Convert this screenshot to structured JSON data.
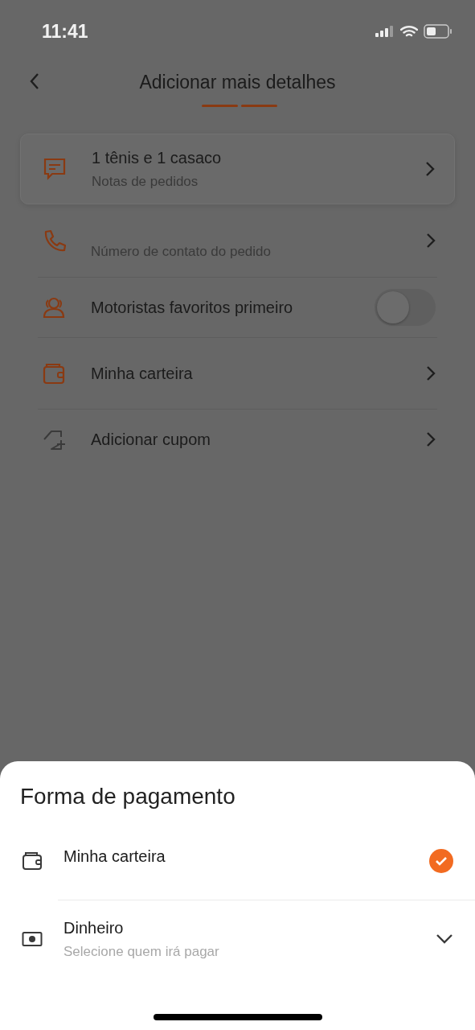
{
  "status_bar": {
    "time": "11:41"
  },
  "header": {
    "title": "Adicionar mais detalhes"
  },
  "details": [
    {
      "kind": "card",
      "title": "1 tênis e 1 casaco",
      "subtitle": "Notas de pedidos"
    },
    {
      "kind": "row",
      "subtitle": "Número de contato do pedido"
    },
    {
      "kind": "toggle",
      "title": "Motoristas favoritos primeiro",
      "on": false
    },
    {
      "kind": "row",
      "title": "Minha carteira"
    },
    {
      "kind": "row",
      "title": "Adicionar cupom"
    }
  ],
  "sheet": {
    "title": "Forma de pagamento",
    "options": [
      {
        "kind": "wallet",
        "title": "Minha carteira",
        "selected": true
      },
      {
        "kind": "cash",
        "title": "Dinheiro",
        "subtitle": "Selecione quem irá pagar",
        "selected": false
      }
    ]
  }
}
